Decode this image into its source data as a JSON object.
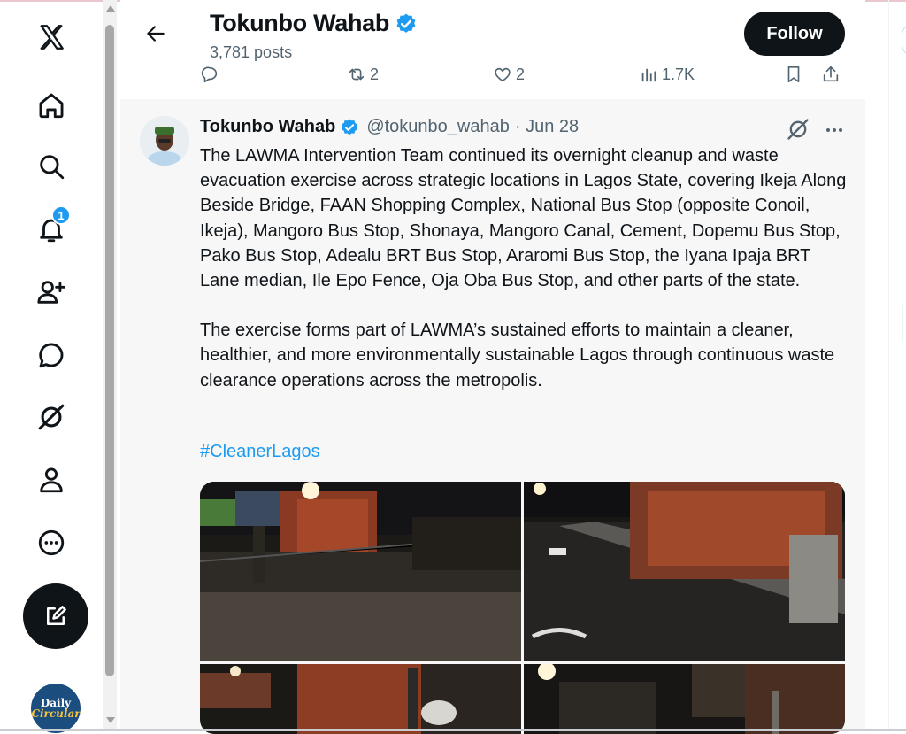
{
  "nav": {
    "items": [
      {
        "name": "x-logo-icon"
      },
      {
        "name": "home-icon"
      },
      {
        "name": "search-icon"
      },
      {
        "name": "notifications-icon"
      },
      {
        "name": "follow-people-icon"
      },
      {
        "name": "messages-icon"
      },
      {
        "name": "grok-icon"
      },
      {
        "name": "profile-icon"
      },
      {
        "name": "more-icon"
      }
    ],
    "notification_count": "1",
    "compose_icon": "compose-icon",
    "account_avatar_line1": "Daily",
    "account_avatar_line2": "Circular"
  },
  "header": {
    "name": "Tokunbo Wahab",
    "posts": "3,781 posts",
    "follow_label": "Follow",
    "verified": true
  },
  "prev_actions": {
    "replies": "",
    "reposts": "2",
    "likes": "2",
    "views": "1.7K"
  },
  "tweet": {
    "author_name": "Tokunbo Wahab",
    "handle": "@tokunbo_wahab",
    "date": "· Jun 28",
    "paragraph1": "The LAWMA Intervention Team continued its overnight cleanup and waste evacuation exercise across strategic locations in Lagos State, covering Ikeja Along Beside Bridge, FAAN Shopping Complex, National Bus Stop (opposite Conoil, Ikeja), Mangoro Bus Stop, Shonaya, Mangoro Canal, Cement, Dopemu Bus Stop, Pako Bus Stop, Adealu BRT Bus Stop, Araromi Bus Stop, the Iyana Ipaja BRT Lane median, Ile Epo Fence, Oja Oba Bus Stop, and other parts of the state.",
    "paragraph2": "The exercise forms part of LAWMA’s sustained efforts to maintain a cleaner, healthier, and more environmentally sustainable Lagos through continuous waste clearance operations across the metropolis.",
    "hashtag": "#CleanerLagos",
    "photo_count": 4
  },
  "colors": {
    "accent": "#1d9bf0",
    "text": "#0f1419",
    "muted": "#536471",
    "button_dark": "#0f1419"
  }
}
